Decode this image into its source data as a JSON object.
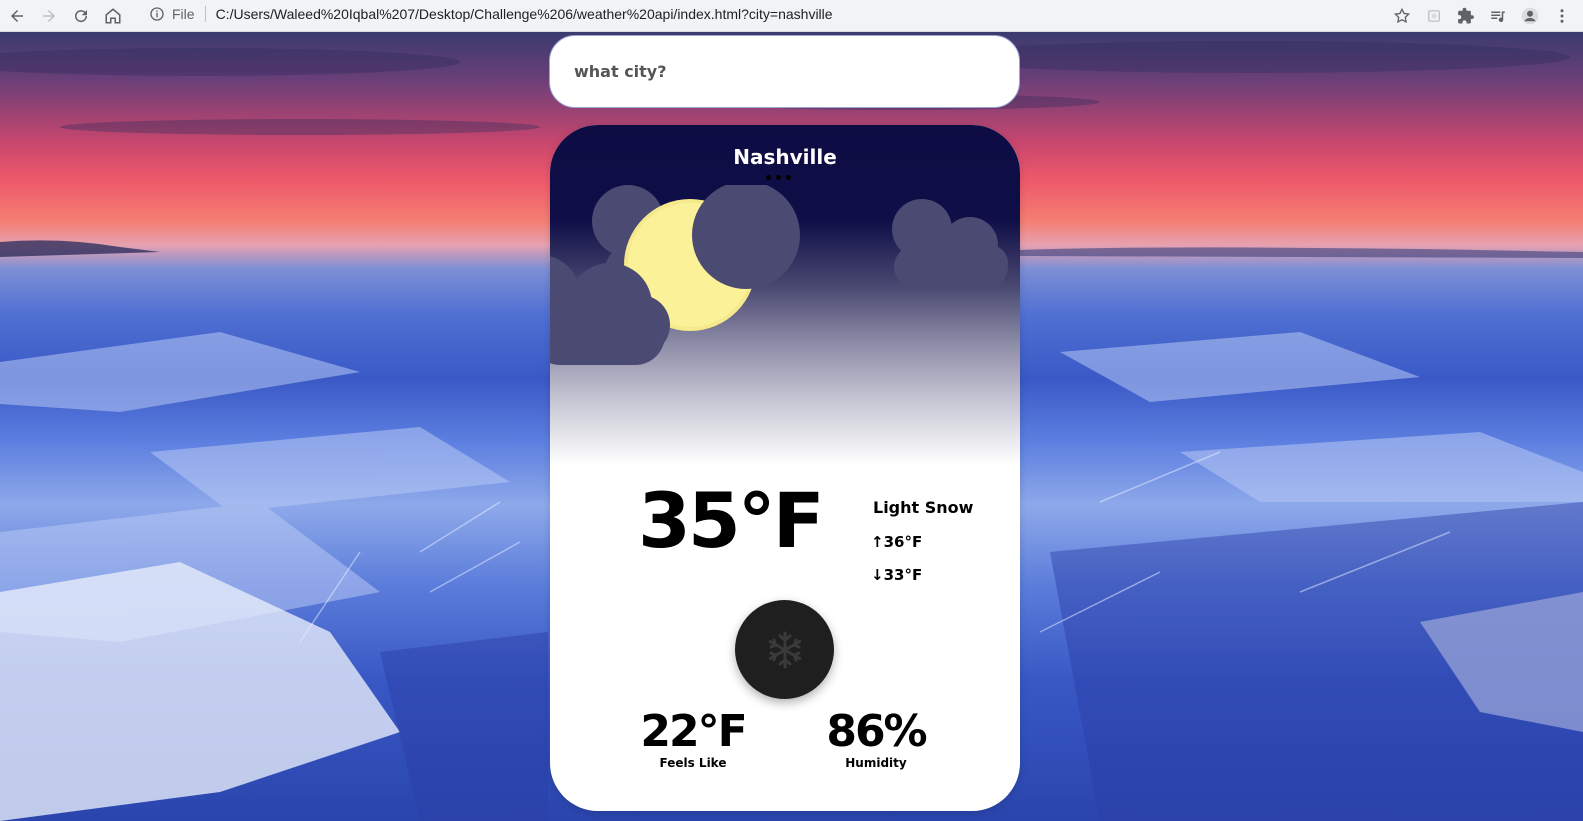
{
  "browser": {
    "file_label": "File",
    "url": "C:/Users/Waleed%20Iqbal%207/Desktop/Challenge%206/weather%20api/index.html?city=nashville"
  },
  "search": {
    "placeholder": "what city?"
  },
  "weather": {
    "city": "Nashville",
    "temperature": "35°F",
    "description": "Light Snow",
    "high": "↑36°F",
    "low": "↓33°F",
    "condition_icon": "snowflake-icon",
    "feels_like_value": "22°F",
    "feels_like_label": "Feels Like",
    "humidity_value": "86%",
    "humidity_label": "Humidity"
  },
  "colors": {
    "sky_top": "#0d0c43",
    "cloud": "#4b4a72",
    "moon": "#fbf199",
    "icon_circle": "#1f1f1f"
  }
}
